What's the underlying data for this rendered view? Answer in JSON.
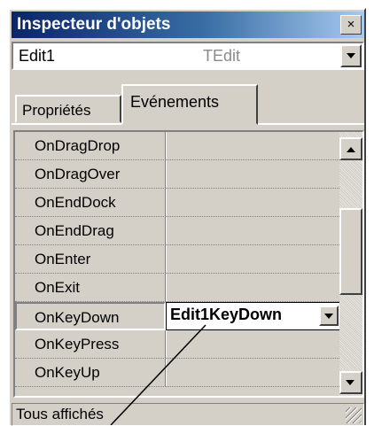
{
  "window": {
    "title": "Inspecteur d'objets",
    "close_label": "×"
  },
  "object_selector": {
    "name": "Edit1",
    "type": "TEdit"
  },
  "tabs": [
    {
      "label": "Propriétés",
      "active": false
    },
    {
      "label": "Evénements",
      "active": true
    }
  ],
  "events": [
    {
      "name": "OnDragDrop",
      "value": ""
    },
    {
      "name": "OnDragOver",
      "value": ""
    },
    {
      "name": "OnEndDock",
      "value": ""
    },
    {
      "name": "OnEndDrag",
      "value": ""
    },
    {
      "name": "OnEnter",
      "value": ""
    },
    {
      "name": "OnExit",
      "value": ""
    },
    {
      "name": "OnKeyDown",
      "value": "Edit1KeyDown"
    },
    {
      "name": "OnKeyPress",
      "value": ""
    },
    {
      "name": "OnKeyUp",
      "value": ""
    }
  ],
  "status": {
    "text": "Tous affichés"
  },
  "colors": {
    "title_start": "#0a246a",
    "title_end": "#a6caf0",
    "face": "#d4d0c8"
  }
}
